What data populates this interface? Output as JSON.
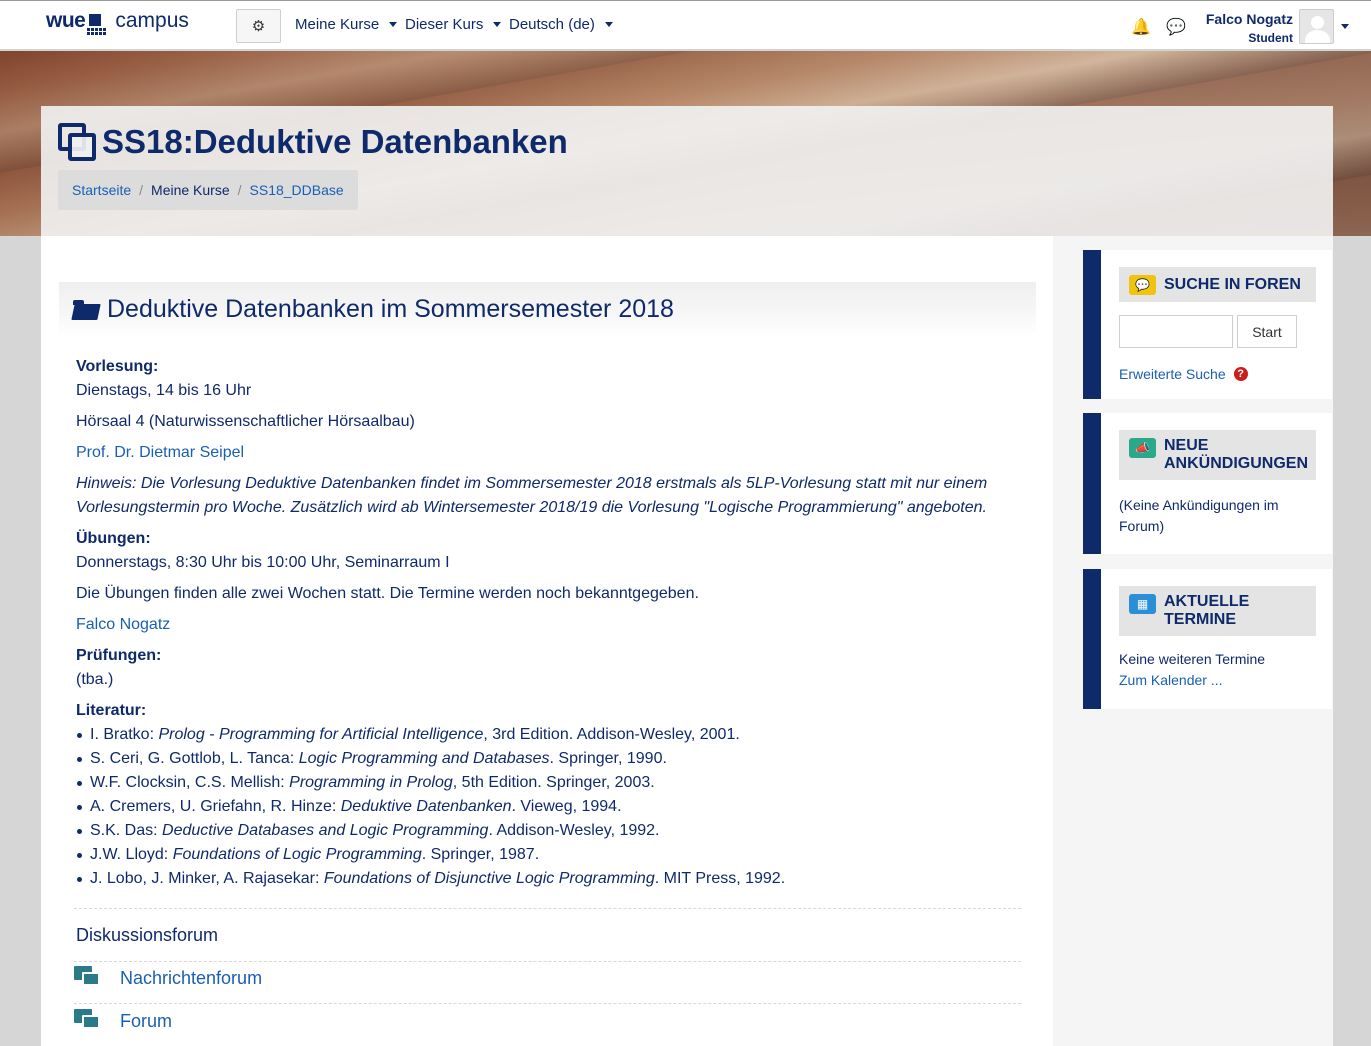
{
  "navbar": {
    "logo_left": "wue",
    "logo_right": "campus",
    "menus": [
      "Meine Kurse",
      "Dieser Kurs",
      "Deutsch (de)"
    ],
    "user_name": "Falco Nogatz",
    "user_role": "Student"
  },
  "header": {
    "title": "SS18:Deduktive Datenbanken",
    "breadcrumb": [
      "Startseite",
      "Meine Kurse",
      "SS18_DDBase"
    ]
  },
  "section": {
    "title": "Deduktive Datenbanken im Sommersemester 2018"
  },
  "content": {
    "vorlesung_label": "Vorlesung:",
    "vorlesung_time": "Dienstags, 14 bis 16 Uhr",
    "vorlesung_room": "Hörsaal 4 (Naturwissenschaftlicher Hörsaalbau)",
    "vorlesung_lecturer": "Prof. Dr. Dietmar Seipel",
    "hint": "Hinweis: Die Vorlesung Deduktive Datenbanken findet im Sommersemester 2018 erstmals als 5LP-Vorlesung statt mit nur einem Vorlesungstermin pro Woche. Zusätzlich wird ab Wintersemester 2018/19 die Vorlesung \"Logische Programmierung\" angeboten.",
    "uebungen_label": "Übungen:",
    "uebungen_time": "Donnerstags, 8:30 Uhr bis 10:00 Uhr, Seminarraum I",
    "uebungen_note": "Die Übungen finden alle zwei Wochen statt. Die Termine werden noch bekanntgegeben.",
    "uebungen_tutor": "Falco Nogatz",
    "pruefungen_label": "Prüfungen:",
    "pruefungen_value": "(tba.)",
    "literatur_label": "Literatur:",
    "literatur": [
      {
        "pre": "I. Bratko: ",
        "title": "Prolog - Programming for Artificial Intelligence",
        "post": ", 3rd Edition. Addison-Wesley, 2001."
      },
      {
        "pre": "S. Ceri, G. Gottlob, L. Tanca: ",
        "title": "Logic Programming and Databases",
        "post": ". Springer, 1990."
      },
      {
        "pre": "W.F. Clocksin, C.S. Mellish: ",
        "title": "Programming in Prolog",
        "post": ", 5th Edition. Springer, 2003."
      },
      {
        "pre": "A. Cremers, U. Griefahn, R. Hinze: ",
        "title": "Deduktive Datenbanken",
        "post": ". Vieweg, 1994."
      },
      {
        "pre": "S.K. Das: ",
        "title": "Deductive Databases and Logic Programming",
        "post": ". Addison-Wesley, 1992."
      },
      {
        "pre": "J.W. Lloyd: ",
        "title": "Foundations of Logic Programming",
        "post": ". Springer, 1987."
      },
      {
        "pre": "J. Lobo, J. Minker, A. Rajasekar: ",
        "title": "Foundations of Disjunctive Logic Programming",
        "post": ". MIT Press, 1992."
      }
    ]
  },
  "forums": {
    "title": "Diskussionsforum",
    "items": [
      "Nachrichtenforum",
      "Forum"
    ]
  },
  "blocks": {
    "search": {
      "title": "SUCHE IN FOREN",
      "button": "Start",
      "advanced": "Erweiterte Suche",
      "icon": "comments-icon",
      "icon_color": "#f0c30f"
    },
    "news": {
      "title": "NEUE ANKÜNDIGUNGEN",
      "text": "(Keine Ankündigungen im Forum)",
      "icon": "megaphone-icon",
      "icon_color": "#2aa98a"
    },
    "events": {
      "title": "AKTUELLE TERMINE",
      "text": "Keine weiteren Termine",
      "link": "Zum Kalender ...",
      "icon": "calendar-icon",
      "icon_color": "#2a8fd6"
    }
  },
  "colors": {
    "brand": "#0f2a6b",
    "link": "#1a5fb4"
  }
}
